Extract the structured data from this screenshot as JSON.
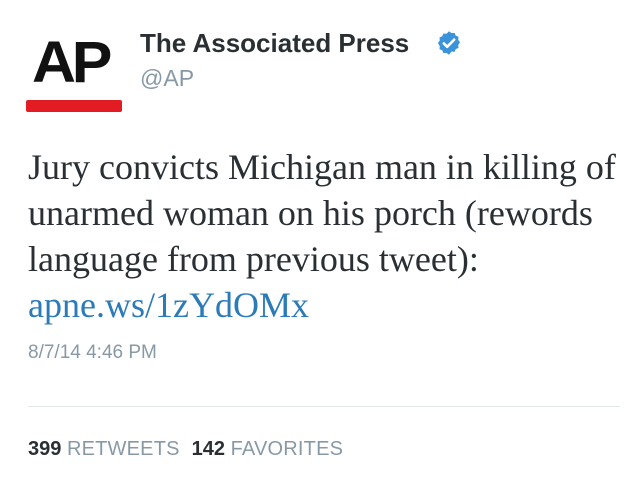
{
  "tweet": {
    "avatar": {
      "logo_text": "AP",
      "logo_color": "#111111",
      "bar_color": "#e31b23"
    },
    "display_name": "The Associated Press",
    "verified_icon": "verified-badge-icon",
    "verified_color": "#3b94d9",
    "handle": "@AP",
    "text": "Jury convicts Michigan man in killing of unarmed woman on his porch (rewords language from previous tweet): ",
    "link": "apne.ws/1zYdOMx",
    "link_color": "#2b7bb9",
    "timestamp": "8/7/14 4:46 PM",
    "stats": {
      "retweets_count": "399",
      "retweets_label": "RETWEETS",
      "favorites_count": "142",
      "favorites_label": "FAVORITES"
    }
  }
}
